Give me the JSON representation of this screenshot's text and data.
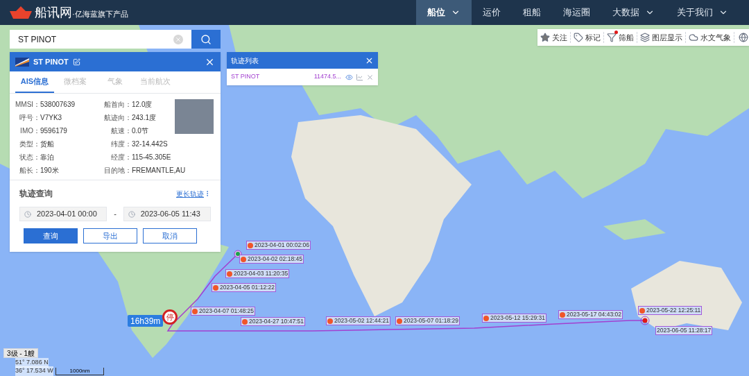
{
  "header": {
    "logo": "船讯网",
    "tagline": "·亿海蓝旗下产品",
    "nav": [
      {
        "label": "船位",
        "selected": true,
        "dropdown": true
      },
      {
        "label": "运价",
        "selected": false,
        "dropdown": false
      },
      {
        "label": "租船",
        "selected": false,
        "dropdown": false
      },
      {
        "label": "海运圈",
        "selected": false,
        "dropdown": false
      },
      {
        "label": "大数据",
        "selected": false,
        "dropdown": true
      },
      {
        "label": "关于我们",
        "selected": false,
        "dropdown": true
      }
    ]
  },
  "toolbar": [
    {
      "kind": "star",
      "label": "关注",
      "badge": false
    },
    {
      "kind": "tag",
      "label": "标记",
      "badge": false
    },
    {
      "kind": "filter",
      "label": "筛船",
      "badge": true
    },
    {
      "kind": "layers",
      "label": "图层显示",
      "badge": false
    },
    {
      "kind": "weather",
      "label": "水文气象",
      "badge": false
    }
  ],
  "search": {
    "value": "ST PINOT"
  },
  "ship_panel": {
    "name": "ST PINOT",
    "tabs": [
      {
        "label": "AIS信息",
        "selected": true
      },
      {
        "label": "微档案",
        "selected": false
      },
      {
        "label": "气象",
        "selected": false
      },
      {
        "label": "当前航次",
        "selected": false
      }
    ],
    "fields_left": [
      {
        "label": "MMSI：",
        "value": "538007639"
      },
      {
        "label": "呼号：",
        "value": "V7YK3"
      },
      {
        "label": "IMO：",
        "value": "9596179"
      },
      {
        "label": "类型：",
        "value": "货船"
      },
      {
        "label": "状态：",
        "value": "靠泊"
      },
      {
        "label": "船长：",
        "value": "190米"
      }
    ],
    "fields_right": [
      {
        "label": "船首向：",
        "value": "12.0度"
      },
      {
        "label": "航迹向：",
        "value": "243.1度"
      },
      {
        "label": "航速：",
        "value": "0.0节"
      },
      {
        "label": "纬度：",
        "value": "32-14.442S"
      },
      {
        "label": "经度：",
        "value": "115-45.305E"
      },
      {
        "label": "目的地：",
        "value": "FREMANTLE,AU"
      }
    ],
    "track_query": {
      "title": "轨迹查询",
      "more_link": "更长轨迹",
      "start": "2023-04-01 00:00",
      "separator": "-",
      "end": "2023-06-05 11:43",
      "buttons": [
        {
          "label": "查询",
          "kind": "primary"
        },
        {
          "label": "导出",
          "kind": "outline"
        },
        {
          "label": "取消",
          "kind": "outline"
        }
      ]
    }
  },
  "track_list": {
    "title": "轨迹列表",
    "rows": [
      {
        "name": "ST PINOT",
        "distance": "11474.5..."
      }
    ]
  },
  "track_labels": [
    {
      "time": "2023-04-01 00:02:06",
      "kind": "event"
    },
    {
      "time": "2023-04-02 02:18:45",
      "kind": "event"
    },
    {
      "time": "2023-04-03 11:20:35",
      "kind": "event"
    },
    {
      "time": "2023-04-05 01:12:22",
      "kind": "event"
    },
    {
      "time": "2023-04-07 01:48:25",
      "kind": "event"
    },
    {
      "time": "2023-04-27 10:47:51",
      "kind": "event"
    },
    {
      "time": "2023-05-02 12:44:21",
      "kind": "event"
    },
    {
      "time": "2023-05-07 01:18:29",
      "kind": "event"
    },
    {
      "time": "2023-05-12 15:29:31",
      "kind": "event"
    },
    {
      "time": "2023-05-17 04:43:02",
      "kind": "event"
    },
    {
      "time": "2023-05-22 12:25:11",
      "kind": "event"
    },
    {
      "time": "2023-06-05 11:28:17",
      "kind": "plain"
    }
  ],
  "duration_badge": "16h39m",
  "stop_pin": "停",
  "status": {
    "level": "3级 - 1艘",
    "lat": "51° 7.086 N",
    "lon": "36° 17.534 W",
    "scale": "1000nm"
  }
}
